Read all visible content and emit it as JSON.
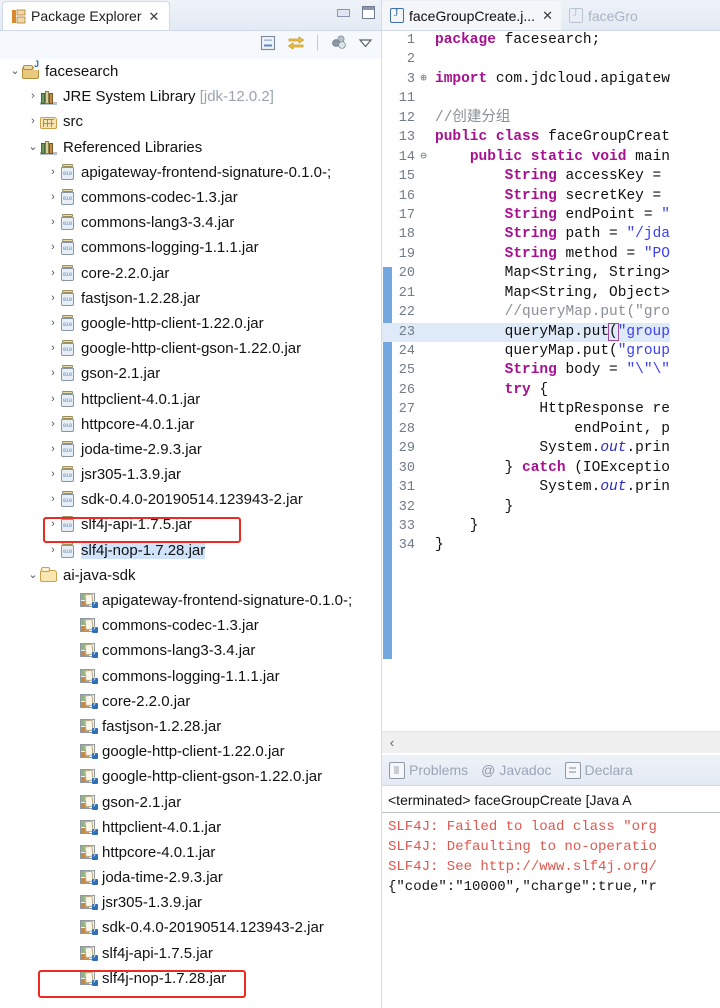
{
  "explorer": {
    "tab_title": "Package Explorer",
    "tab_close_glyph": "✕",
    "toolbar_icons": [
      "collapse-all-icon",
      "link-with-editor-icon",
      "view-menu-group-icon",
      "view-menu-chevron-icon"
    ],
    "window_buttons": [
      "minimize-button",
      "maximize-button"
    ],
    "tree": [
      {
        "label": "facesearch",
        "icon": "java-project-icon",
        "indent": 0,
        "twisty": "v",
        "selected": false
      },
      {
        "label": "JRE System Library ",
        "suffix": "[jdk-12.0.2]",
        "icon": "library-icon",
        "indent": 1,
        "twisty": ">",
        "selected": false
      },
      {
        "label": "src",
        "icon": "source-folder-icon",
        "indent": 1,
        "twisty": ">",
        "selected": false
      },
      {
        "label": "Referenced Libraries",
        "icon": "library-icon",
        "indent": 1,
        "twisty": "v",
        "selected": false
      },
      {
        "label": "apigateway-frontend-signature-0.1.0-;",
        "icon": "jar-icon",
        "indent": 2,
        "twisty": ">",
        "selected": false
      },
      {
        "label": "commons-codec-1.3.jar",
        "icon": "jar-icon",
        "indent": 2,
        "twisty": ">",
        "selected": false
      },
      {
        "label": "commons-lang3-3.4.jar",
        "icon": "jar-icon",
        "indent": 2,
        "twisty": ">",
        "selected": false
      },
      {
        "label": "commons-logging-1.1.1.jar",
        "icon": "jar-icon",
        "indent": 2,
        "twisty": ">",
        "selected": false
      },
      {
        "label": "core-2.2.0.jar",
        "icon": "jar-icon",
        "indent": 2,
        "twisty": ">",
        "selected": false
      },
      {
        "label": "fastjson-1.2.28.jar",
        "icon": "jar-icon",
        "indent": 2,
        "twisty": ">",
        "selected": false
      },
      {
        "label": "google-http-client-1.22.0.jar",
        "icon": "jar-icon",
        "indent": 2,
        "twisty": ">",
        "selected": false
      },
      {
        "label": "google-http-client-gson-1.22.0.jar",
        "icon": "jar-icon",
        "indent": 2,
        "twisty": ">",
        "selected": false
      },
      {
        "label": "gson-2.1.jar",
        "icon": "jar-icon",
        "indent": 2,
        "twisty": ">",
        "selected": false
      },
      {
        "label": "httpclient-4.0.1.jar",
        "icon": "jar-icon",
        "indent": 2,
        "twisty": ">",
        "selected": false
      },
      {
        "label": "httpcore-4.0.1.jar",
        "icon": "jar-icon",
        "indent": 2,
        "twisty": ">",
        "selected": false
      },
      {
        "label": "joda-time-2.9.3.jar",
        "icon": "jar-icon",
        "indent": 2,
        "twisty": ">",
        "selected": false
      },
      {
        "label": "jsr305-1.3.9.jar",
        "icon": "jar-icon",
        "indent": 2,
        "twisty": ">",
        "selected": false
      },
      {
        "label": "sdk-0.4.0-20190514.123943-2.jar",
        "icon": "jar-icon",
        "indent": 2,
        "twisty": ">",
        "selected": false
      },
      {
        "label": "slf4j-api-1.7.5.jar",
        "icon": "jar-icon",
        "indent": 2,
        "twisty": ">",
        "selected": false
      },
      {
        "label": "slf4j-nop-1.7.28.jar",
        "icon": "jar-icon",
        "indent": 2,
        "twisty": ">",
        "selected": true
      },
      {
        "label": "ai-java-sdk",
        "icon": "folder-icon",
        "indent": 1,
        "twisty": "v",
        "selected": false
      },
      {
        "label": "apigateway-frontend-signature-0.1.0-;",
        "icon": "jar-file-icon",
        "indent": 3,
        "twisty": "",
        "selected": false
      },
      {
        "label": "commons-codec-1.3.jar",
        "icon": "jar-file-icon",
        "indent": 3,
        "twisty": "",
        "selected": false
      },
      {
        "label": "commons-lang3-3.4.jar",
        "icon": "jar-file-icon",
        "indent": 3,
        "twisty": "",
        "selected": false
      },
      {
        "label": "commons-logging-1.1.1.jar",
        "icon": "jar-file-icon",
        "indent": 3,
        "twisty": "",
        "selected": false
      },
      {
        "label": "core-2.2.0.jar",
        "icon": "jar-file-icon",
        "indent": 3,
        "twisty": "",
        "selected": false
      },
      {
        "label": "fastjson-1.2.28.jar",
        "icon": "jar-file-icon",
        "indent": 3,
        "twisty": "",
        "selected": false
      },
      {
        "label": "google-http-client-1.22.0.jar",
        "icon": "jar-file-icon",
        "indent": 3,
        "twisty": "",
        "selected": false
      },
      {
        "label": "google-http-client-gson-1.22.0.jar",
        "icon": "jar-file-icon",
        "indent": 3,
        "twisty": "",
        "selected": false
      },
      {
        "label": "gson-2.1.jar",
        "icon": "jar-file-icon",
        "indent": 3,
        "twisty": "",
        "selected": false
      },
      {
        "label": "httpclient-4.0.1.jar",
        "icon": "jar-file-icon",
        "indent": 3,
        "twisty": "",
        "selected": false
      },
      {
        "label": "httpcore-4.0.1.jar",
        "icon": "jar-file-icon",
        "indent": 3,
        "twisty": "",
        "selected": false
      },
      {
        "label": "joda-time-2.9.3.jar",
        "icon": "jar-file-icon",
        "indent": 3,
        "twisty": "",
        "selected": false
      },
      {
        "label": "jsr305-1.3.9.jar",
        "icon": "jar-file-icon",
        "indent": 3,
        "twisty": "",
        "selected": false
      },
      {
        "label": "sdk-0.4.0-20190514.123943-2.jar",
        "icon": "jar-file-icon",
        "indent": 3,
        "twisty": "",
        "selected": false
      },
      {
        "label": "slf4j-api-1.7.5.jar",
        "icon": "jar-file-icon",
        "indent": 3,
        "twisty": "",
        "selected": false
      },
      {
        "label": "slf4j-nop-1.7.28.jar",
        "icon": "jar-file-icon",
        "indent": 3,
        "twisty": "",
        "selected": false
      }
    ],
    "annotation_color": "#ec2b23",
    "annotated_rows": [
      19,
      36
    ]
  },
  "editor": {
    "tabs": [
      {
        "label": "faceGroupCreate.j...",
        "active": true,
        "close_glyph": "✕"
      },
      {
        "label": "faceGro",
        "active": false,
        "close_glyph": ""
      }
    ],
    "lines": [
      {
        "n": "1",
        "fold": "",
        "html": "<span class='kw'>package</span> facesearch;"
      },
      {
        "n": "2",
        "fold": "",
        "html": ""
      },
      {
        "n": "3",
        "fold": "+",
        "html": "<span class='kw'>import</span> com.jdcloud.apigatew"
      },
      {
        "n": "11",
        "fold": "",
        "html": ""
      },
      {
        "n": "12",
        "fold": "",
        "html": "<span class='cmt-gray'>//创建分组</span>"
      },
      {
        "n": "13",
        "fold": "",
        "html": "<span class='kw'>public</span> <span class='kw'>class</span> faceGroupCreat"
      },
      {
        "n": "14",
        "fold": "-",
        "html": "    <span class='kw'>public</span> <span class='kw'>static</span> <span class='kw'>void</span> main"
      },
      {
        "n": "15",
        "fold": "",
        "html": "        <span class='kw'>String</span> accessKey = "
      },
      {
        "n": "16",
        "fold": "",
        "html": "        <span class='kw'>String</span> secretKey = "
      },
      {
        "n": "17",
        "fold": "",
        "html": "        <span class='kw'>String</span> endPoint = <span class='str'>\"</span>"
      },
      {
        "n": "18",
        "fold": "",
        "html": "        <span class='kw'>String</span> path = <span class='str'>\"/jda</span>"
      },
      {
        "n": "19",
        "fold": "",
        "html": "        <span class='kw'>String</span> method = <span class='str'>\"PO</span>"
      },
      {
        "n": "20",
        "fold": "",
        "html": "        Map&lt;String, String&gt;"
      },
      {
        "n": "21",
        "fold": "",
        "html": "        Map&lt;String, Object&gt;"
      },
      {
        "n": "22",
        "fold": "",
        "html": "        <span class='cmt-gray'>//queryMap.put(\"gro</span>"
      },
      {
        "n": "23",
        "fold": "",
        "html": "        queryMap.put<span class='brk'>(</span><span class='str'>\"group</span>",
        "hl": true
      },
      {
        "n": "24",
        "fold": "",
        "html": "        queryMap.put(<span class='str'>\"group</span>"
      },
      {
        "n": "25",
        "fold": "",
        "html": "        <span class='kw'>String</span> body = <span class='str'>\"\\\"\\\"</span>"
      },
      {
        "n": "26",
        "fold": "",
        "html": "        <span class='kw'>try</span> {"
      },
      {
        "n": "27",
        "fold": "",
        "html": "            HttpResponse re"
      },
      {
        "n": "28",
        "fold": "",
        "html": "                endPoint, p"
      },
      {
        "n": "29",
        "fold": "",
        "html": "            System.<span class='stat'>out</span>.prin"
      },
      {
        "n": "30",
        "fold": "",
        "html": "        } <span class='kw'>catch</span> (IOExceptio"
      },
      {
        "n": "31",
        "fold": "",
        "html": "            System.<span class='stat'>out</span>.prin"
      },
      {
        "n": "32",
        "fold": "",
        "html": "        }"
      },
      {
        "n": "33",
        "fold": "",
        "html": "    }"
      },
      {
        "n": "34",
        "fold": "",
        "html": "}"
      }
    ],
    "hscroll_left_glyph": "‹"
  },
  "bottom_panel": {
    "tabs": [
      {
        "label": "Problems",
        "icon": "problems-icon"
      },
      {
        "label": "Javadoc",
        "icon": "javadoc-at-icon"
      },
      {
        "label": "Declara",
        "icon": "declaration-icon"
      }
    ],
    "console_header": "<terminated> faceGroupCreate [Java A",
    "console_lines": [
      {
        "text": "SLF4J: Failed to load class \"org",
        "type": "error"
      },
      {
        "text": "SLF4J: Defaulting to no-operatio",
        "type": "error"
      },
      {
        "text": "SLF4J: See http://www.slf4j.org/",
        "type": "error"
      },
      {
        "text": "{\"code\":\"10000\",\"charge\":true,\"r",
        "type": "out"
      }
    ],
    "error_color": "#e0574f"
  }
}
